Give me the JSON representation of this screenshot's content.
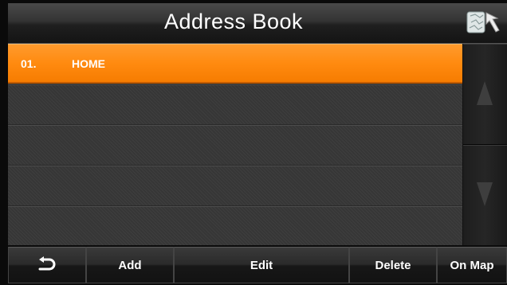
{
  "header": {
    "title": "Address Book",
    "map_nav_icon": "map-return-icon"
  },
  "list": {
    "rows": [
      {
        "num": "01.",
        "name": "HOME",
        "selected": true
      },
      {
        "num": "",
        "name": "",
        "selected": false
      },
      {
        "num": "",
        "name": "",
        "selected": false
      },
      {
        "num": "",
        "name": "",
        "selected": false
      },
      {
        "num": "",
        "name": "",
        "selected": false
      }
    ]
  },
  "scroll": {
    "up_icon": "arrow-up-icon",
    "down_icon": "arrow-down-icon"
  },
  "toolbar": {
    "back_icon": "back-arrow-icon",
    "add_label": "Add",
    "edit_label": "Edit",
    "delete_label": "Delete",
    "onmap_label": "On Map"
  },
  "colors": {
    "accent": "#ff8a0f",
    "background": "#0a0a0a"
  }
}
